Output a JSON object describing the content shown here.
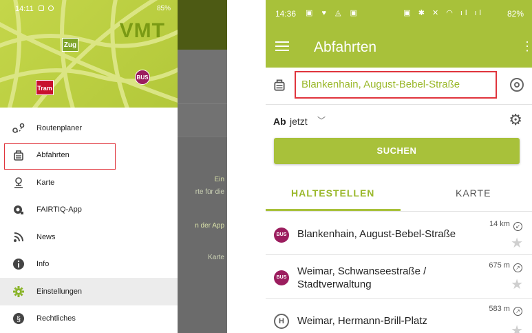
{
  "left_screen": {
    "status": {
      "time": "14:11",
      "battery": "85%"
    },
    "brand": {
      "logo_text": "VMT",
      "tag_zug": "Zug",
      "tag_tram": "Tram",
      "tag_bus": "BUS"
    },
    "background_texts": [
      "Ein",
      "rte für die",
      "n der App",
      "Karte"
    ],
    "menu_items": [
      {
        "label": "Routenplaner",
        "icon": "route-icon"
      },
      {
        "label": "Abfahrten",
        "icon": "departure-board-icon",
        "highlighted": true
      },
      {
        "label": "Karte",
        "icon": "map-pin-icon"
      },
      {
        "label": "FAIRTIQ-App",
        "icon": "fairtiq-icon"
      },
      {
        "label": "News",
        "icon": "rss-icon"
      },
      {
        "label": "Info",
        "icon": "info-icon"
      },
      {
        "label": "Einstellungen",
        "icon": "gear-icon",
        "active": true
      },
      {
        "label": "Rechtliches",
        "icon": "paragraph-icon"
      }
    ]
  },
  "right_screen": {
    "status": {
      "time": "14:36",
      "battery": "82%"
    },
    "title": "Abfahrten",
    "from": {
      "value": "Blankenhain, August-Bebel-Straße"
    },
    "time_label": "Ab",
    "time_value": "jetzt",
    "search_button": "SUCHEN",
    "tabs": [
      "HALTESTELLEN",
      "KARTE"
    ],
    "stops": [
      {
        "type": "BUS",
        "name_line1": "Blankenhain, August-Bebel-Straße",
        "name_line2": "",
        "distance": "14 km"
      },
      {
        "type": "BUS",
        "name_line1": "Weimar, Schwanseestraße /",
        "name_line2": "Stadtverwaltung",
        "distance": "675 m"
      },
      {
        "type": "H",
        "name_line1": "Weimar, Hermann-Brill-Platz",
        "name_line2": "",
        "distance": "583 m"
      }
    ],
    "colors": {
      "accent": "#a8c13a",
      "highlight_box": "#e0343c",
      "bus_badge": "#9b1d5e"
    }
  }
}
